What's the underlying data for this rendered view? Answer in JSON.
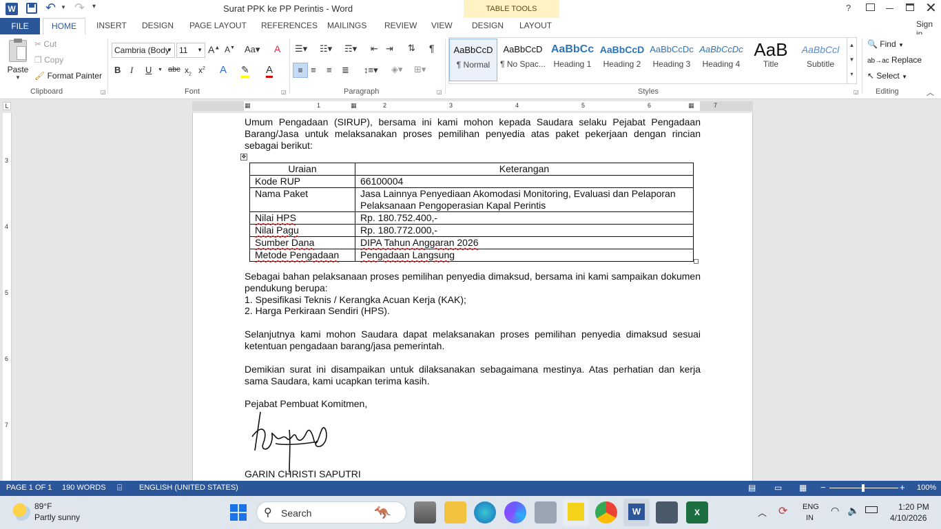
{
  "window": {
    "title": "Surat PPK ke PP Perintis - Word",
    "contextual_tab_group": "TABLE TOOLS",
    "sign_in": "Sign in"
  },
  "tabs": [
    "FILE",
    "HOME",
    "INSERT",
    "DESIGN",
    "PAGE LAYOUT",
    "REFERENCES",
    "MAILINGS",
    "REVIEW",
    "VIEW",
    "DESIGN",
    "LAYOUT"
  ],
  "ribbon": {
    "clipboard": {
      "paste": "Paste",
      "cut": "Cut",
      "copy": "Copy",
      "format_painter": "Format Painter",
      "label": "Clipboard"
    },
    "font": {
      "name": "Cambria (Body",
      "size": "11",
      "label": "Font"
    },
    "paragraph": {
      "label": "Paragraph"
    },
    "styles": {
      "label": "Styles",
      "items": [
        {
          "sample": "AaBbCcD",
          "name": "¶ Normal"
        },
        {
          "sample": "AaBbCcD",
          "name": "¶ No Spac..."
        },
        {
          "sample": "AaBbCc",
          "name": "Heading 1"
        },
        {
          "sample": "AaBbCcD",
          "name": "Heading 2"
        },
        {
          "sample": "AaBbCcDc",
          "name": "Heading 3"
        },
        {
          "sample": "AaBbCcDc",
          "name": "Heading 4"
        },
        {
          "sample": "AaB",
          "name": "Title"
        },
        {
          "sample": "AaBbCcl",
          "name": "Subtitle"
        }
      ]
    },
    "editing": {
      "find": "Find",
      "replace": "Replace",
      "select": "Select",
      "label": "Editing"
    }
  },
  "ruler": {
    "marks": [
      "1",
      "2",
      "3",
      "4",
      "5",
      "6",
      "7"
    ]
  },
  "vruler": {
    "marks": [
      "3",
      "4",
      "5",
      "6",
      "7"
    ]
  },
  "document": {
    "intro": "Umum Pengadaan (SIRUP), bersama ini kami mohon kepada Saudara selaku Pejabat Pengadaan Barang/Jasa untuk melaksanakan proses pemilihan penyedia atas paket pekerjaan dengan rincian sebagai berikut:",
    "table_headers": [
      "Uraian",
      "Keterangan"
    ],
    "table_rows": [
      [
        "Kode RUP",
        "66100004"
      ],
      [
        "Nama Paket",
        "Jasa Lainnya Penyediaan Akomodasi Monitoring, Evaluasi dan Pelaporan Pelaksanaan Pengoperasian Kapal Perintis"
      ],
      [
        "Nilai HPS",
        "Rp. 180.752.400,-"
      ],
      [
        "Nilai Pagu",
        "Rp. 180.772.000,-"
      ],
      [
        "Sumber Dana",
        "DIPA Tahun Anggaran 2026"
      ],
      [
        "Metode Pengadaan",
        "Pengadaan Langsung"
      ]
    ],
    "para2": "Sebagai bahan pelaksanaan proses pemilihan penyedia dimaksud, bersama ini kami sampaikan dokumen pendukung berupa:",
    "list": [
      "1.  Spesifikasi Teknis / Kerangka Acuan Kerja (KAK);",
      "2.  Harga Perkiraan Sendiri (HPS)."
    ],
    "para3": "Selanjutnya kami mohon Saudara dapat melaksanakan proses pemilihan penyedia dimaksud sesuai ketentuan pengadaan barang/jasa pemerintah.",
    "para4": "Demikian surat ini disampaikan untuk dilaksanakan sebagaimana mestinya. Atas perhatian dan kerja sama Saudara, kami ucapkan terima kasih.",
    "closing": "Pejabat Pembuat Komitmen,",
    "signer": "GARIN CHRISTI SAPUTRI"
  },
  "status": {
    "page": "PAGE 1 OF 1",
    "words": "190 WORDS",
    "language": "ENGLISH (UNITED STATES)",
    "zoom": "100%"
  },
  "taskbar": {
    "weather_temp": "89°F",
    "weather_desc": "Partly sunny",
    "search": "Search",
    "lang1": "ENG",
    "lang2": "IN",
    "time": "1:20 PM",
    "date": "4/10/2026"
  },
  "colors": {
    "accent": "#2b579a",
    "table_tools": "#fff3c6"
  }
}
